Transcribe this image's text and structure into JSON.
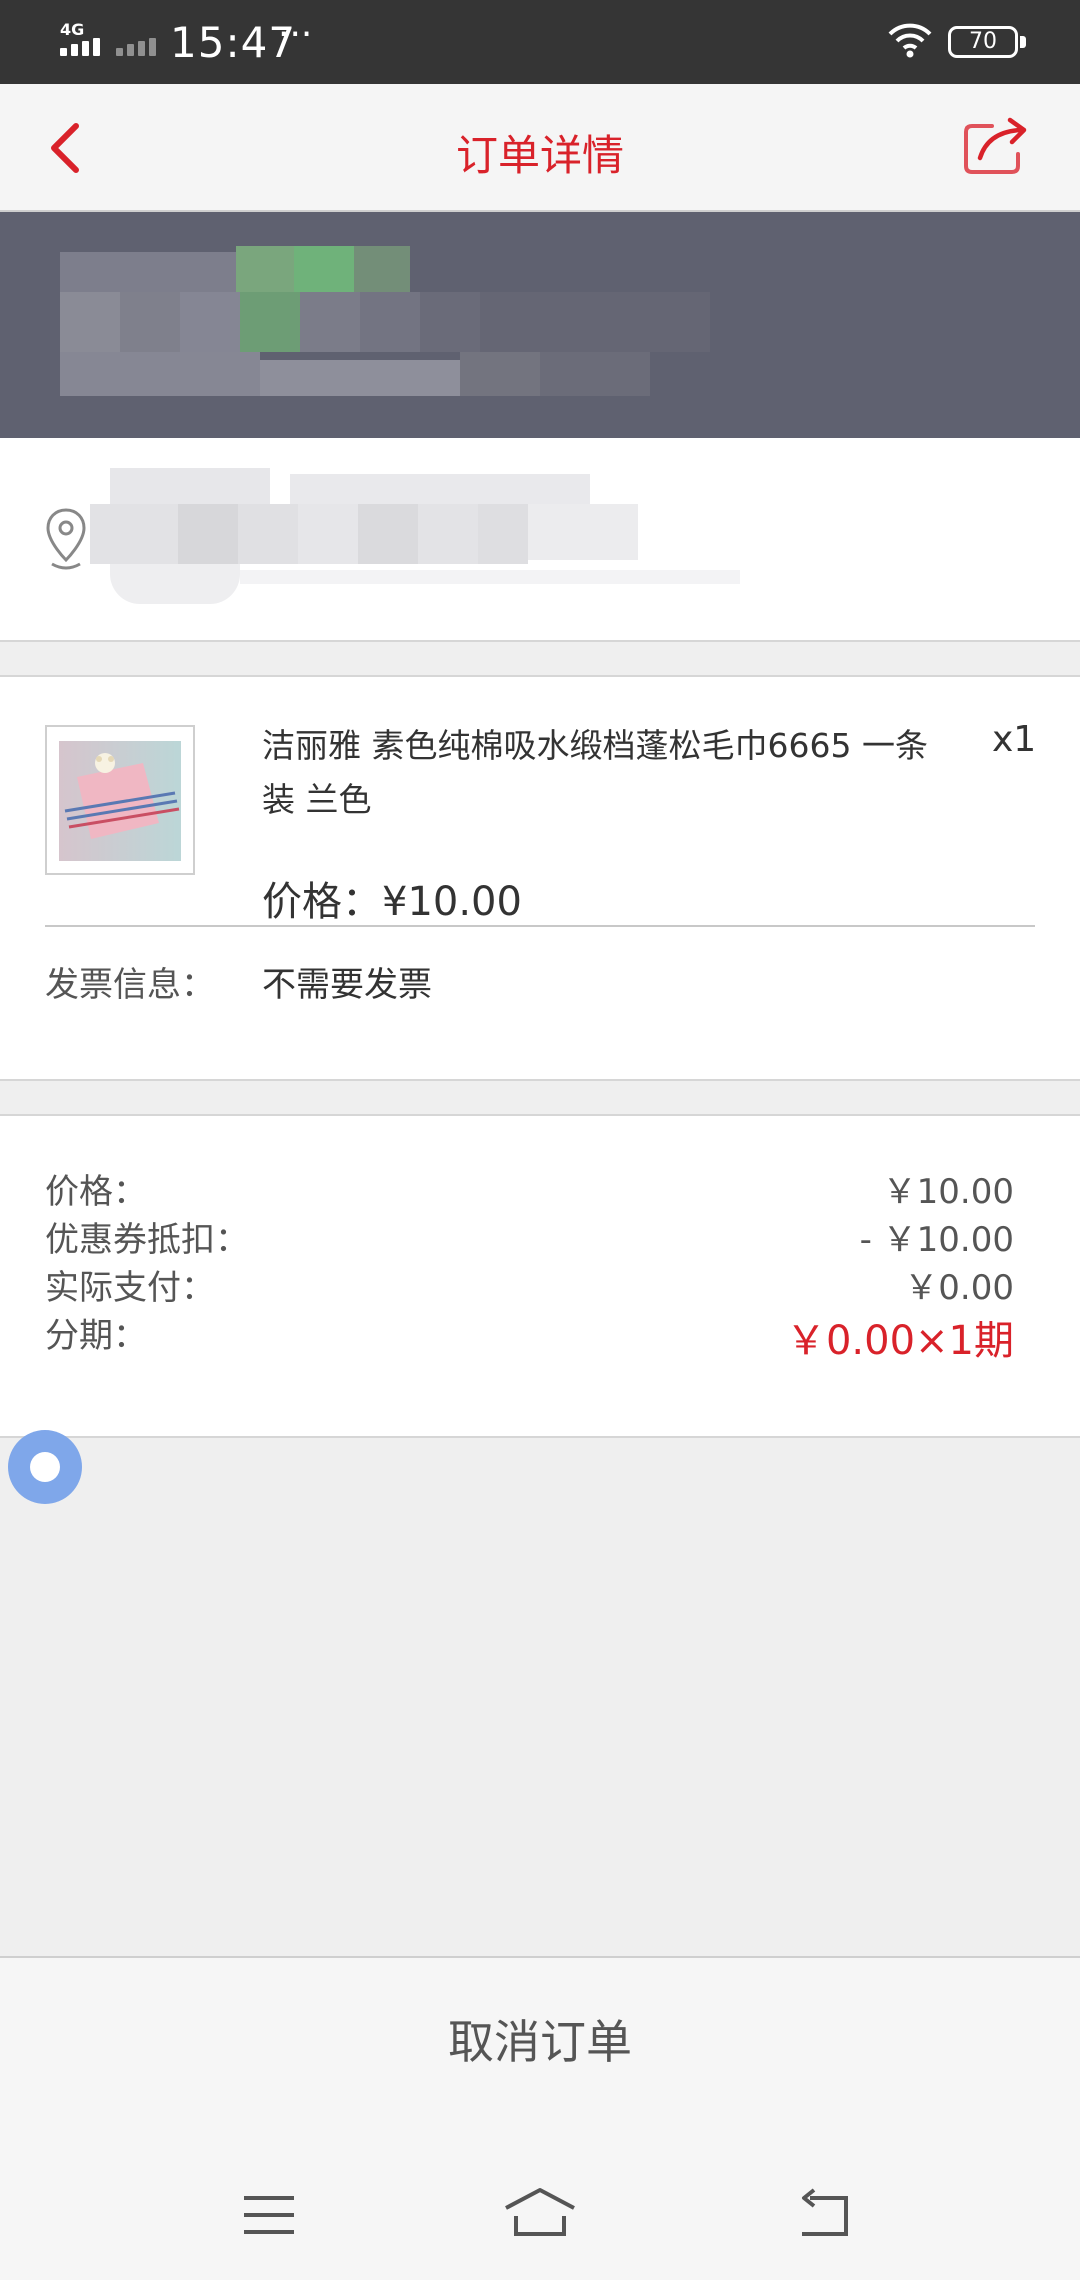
{
  "status_bar": {
    "network": "4G",
    "time": "15:47",
    "more": "···",
    "battery": "70"
  },
  "header": {
    "title": "订单详情",
    "back_icon": "chevron-left-icon",
    "share_icon": "share-icon"
  },
  "product": {
    "title": "洁丽雅 素色纯棉吸水缎档蓬松毛巾6665 一条装 兰色",
    "quantity": "x1",
    "price": "价格：¥10.00",
    "invoice_label": "发票信息：",
    "invoice_value": "不需要发票"
  },
  "summary": {
    "rows": [
      {
        "label": "价格：",
        "value": "￥10.00"
      },
      {
        "label": "优惠券抵扣：",
        "value": "- ￥10.00"
      },
      {
        "label": "实际支付：",
        "value": "￥0.00"
      },
      {
        "label": "分期：",
        "value": "￥0.00×1期"
      }
    ]
  },
  "actions": {
    "cancel": "取消订单"
  },
  "colors": {
    "accent": "#d9222a",
    "status_panel": "#5f6170",
    "float_button": "#7fa7ea"
  }
}
